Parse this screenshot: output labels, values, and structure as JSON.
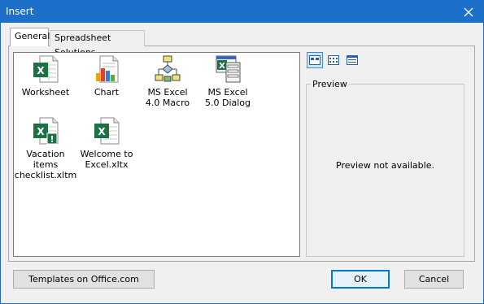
{
  "window": {
    "title": "Insert"
  },
  "tabs": [
    {
      "label": "General",
      "active": true
    },
    {
      "label": "Spreadsheet Solutions",
      "active": false
    }
  ],
  "items": [
    {
      "label": "Worksheet",
      "icon": "excel-worksheet-icon",
      "selected": true
    },
    {
      "label": "Chart",
      "icon": "chart-document-icon",
      "selected": false
    },
    {
      "label": "MS Excel 4.0 Macro",
      "icon": "macro-flowchart-icon",
      "selected": false
    },
    {
      "label": "MS Excel 5.0 Dialog",
      "icon": "dialog-sheet-icon",
      "selected": false
    },
    {
      "label": "Vacation items checklist.xltm",
      "icon": "excel-macro-template-icon",
      "selected": false
    },
    {
      "label": "Welcome to Excel.xltx",
      "icon": "excel-template-icon",
      "selected": false
    }
  ],
  "view_buttons": [
    {
      "name": "large-icons-view",
      "active": true
    },
    {
      "name": "list-view",
      "active": false
    },
    {
      "name": "details-view",
      "active": false
    }
  ],
  "preview": {
    "legend": "Preview",
    "message": "Preview not available."
  },
  "buttons": {
    "templates": "Templates on Office.com",
    "ok": "OK",
    "cancel": "Cancel"
  },
  "colors": {
    "titlebar": "#1b70c9",
    "selection": "#0078d7",
    "excel_green": "#1e7145"
  }
}
